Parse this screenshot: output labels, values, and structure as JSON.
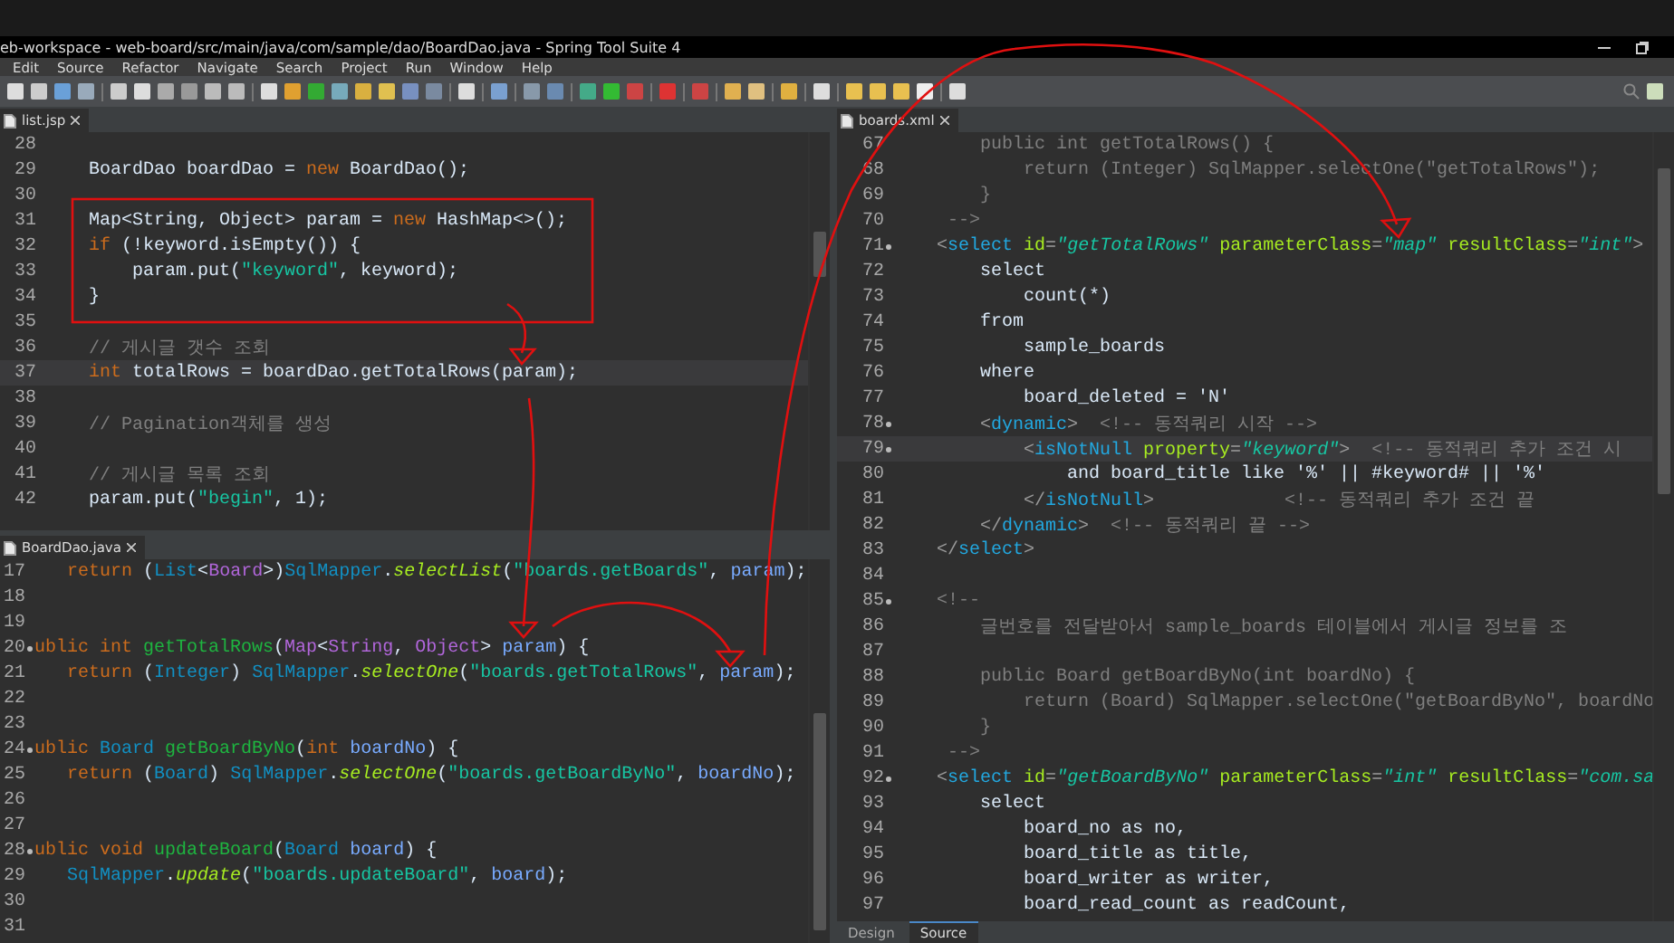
{
  "window": {
    "title": "eb-workspace - web-board/src/main/java/com/sample/dao/BoardDao.java - Spring Tool Suite 4"
  },
  "menu": [
    "Edit",
    "Source",
    "Refactor",
    "Navigate",
    "Search",
    "Project",
    "Run",
    "Window",
    "Help"
  ],
  "editors": [
    {
      "tab": "list.jsp",
      "lines": [
        {
          "number": "28",
          "fold": false,
          "current": false
        },
        {
          "number": "29",
          "fold": false,
          "current": false,
          "segments": [
            {
              "text": "    BoardDao boardDao = ",
              "kind": "plain"
            },
            {
              "text": "new",
              "kind": "kw"
            },
            {
              "text": " BoardDao();",
              "kind": "plain"
            }
          ]
        },
        {
          "number": "30",
          "fold": false,
          "current": false
        },
        {
          "number": "31",
          "fold": false,
          "current": false,
          "segments": [
            {
              "text": "    Map<String, Object> param = ",
              "kind": "plain"
            },
            {
              "text": "new",
              "kind": "kw"
            },
            {
              "text": " HashMap<>();",
              "kind": "plain"
            }
          ]
        },
        {
          "number": "32",
          "fold": false,
          "current": false,
          "segments": [
            {
              "text": "    if",
              "kind": "kw"
            },
            {
              "text": " (!keyword.isEmpty()) {",
              "kind": "plain"
            }
          ]
        },
        {
          "number": "33",
          "fold": false,
          "current": false,
          "segments": [
            {
              "text": "        param.put(",
              "kind": "plain"
            },
            {
              "text": "\"keyword\"",
              "kind": "str"
            },
            {
              "text": ", keyword);",
              "kind": "plain"
            }
          ]
        },
        {
          "number": "34",
          "fold": false,
          "current": false,
          "segments": [
            {
              "text": "    }",
              "kind": "plain"
            }
          ]
        },
        {
          "number": "35",
          "fold": false,
          "current": false
        },
        {
          "number": "36",
          "fold": false,
          "current": false,
          "segments": [
            {
              "text": "    // 게시글 갯수 조회",
              "kind": "cmt"
            }
          ]
        },
        {
          "number": "37",
          "fold": false,
          "current": true,
          "segments": [
            {
              "text": "    int",
              "kind": "kw"
            },
            {
              "text": " totalRows = boardDao.getTotalRows(param);",
              "kind": "plain"
            }
          ]
        },
        {
          "number": "38",
          "fold": false,
          "current": false
        },
        {
          "number": "39",
          "fold": false,
          "current": false,
          "segments": [
            {
              "text": "    // Pagination객체를 생성",
              "kind": "cmt"
            }
          ]
        },
        {
          "number": "40",
          "fold": false,
          "current": false
        },
        {
          "number": "41",
          "fold": false,
          "current": false,
          "segments": [
            {
              "text": "    // 게시글 목록 조회",
              "kind": "cmt"
            }
          ]
        },
        {
          "number": "42",
          "fold": false,
          "current": false,
          "segments": [
            {
              "text": "    param.put(",
              "kind": "plain"
            },
            {
              "text": "\"begin\"",
              "kind": "str"
            },
            {
              "text": ", 1);",
              "kind": "plain"
            }
          ]
        }
      ]
    },
    {
      "tab": "BoardDao.java",
      "lines": [
        {
          "number": "17",
          "fold": false,
          "current": false,
          "segments": [
            {
              "text": "   return",
              "kind": "kw"
            },
            {
              "text": " (",
              "kind": "plain"
            },
            {
              "text": "List",
              "kind": "type"
            },
            {
              "text": "<",
              "kind": "plain"
            },
            {
              "text": "Board",
              "kind": "generic"
            },
            {
              "text": ">)",
              "kind": "plain"
            },
            {
              "text": "SqlMapper",
              "kind": "type"
            },
            {
              "text": ".",
              "kind": "plain"
            },
            {
              "text": "selectList",
              "kind": "call"
            },
            {
              "text": "(",
              "kind": "plain"
            },
            {
              "text": "\"boards.getBoards\"",
              "kind": "str"
            },
            {
              "text": ", ",
              "kind": "plain"
            },
            {
              "text": "param",
              "kind": "var"
            },
            {
              "text": ");",
              "kind": "plain"
            }
          ]
        },
        {
          "number": "18",
          "fold": false,
          "current": false
        },
        {
          "number": "19",
          "fold": false,
          "current": false
        },
        {
          "number": "20",
          "fold": true,
          "current": false,
          "segments": [
            {
              "text": "ublic int",
              "kind": "kw"
            },
            {
              "text": " getTotalRows",
              "kind": "decl"
            },
            {
              "text": "(",
              "kind": "plain"
            },
            {
              "text": "Map",
              "kind": "generic"
            },
            {
              "text": "<",
              "kind": "plain"
            },
            {
              "text": "String",
              "kind": "generic"
            },
            {
              "text": ", ",
              "kind": "plain"
            },
            {
              "text": "Object",
              "kind": "generic"
            },
            {
              "text": "> ",
              "kind": "plain"
            },
            {
              "text": "param",
              "kind": "var"
            },
            {
              "text": ") {",
              "kind": "plain"
            }
          ]
        },
        {
          "number": "21",
          "fold": false,
          "current": false,
          "segments": [
            {
              "text": "   return",
              "kind": "kw"
            },
            {
              "text": " (",
              "kind": "plain"
            },
            {
              "text": "Integer",
              "kind": "type"
            },
            {
              "text": ") ",
              "kind": "plain"
            },
            {
              "text": "SqlMapper",
              "kind": "type"
            },
            {
              "text": ".",
              "kind": "plain"
            },
            {
              "text": "selectOne",
              "kind": "call"
            },
            {
              "text": "(",
              "kind": "plain"
            },
            {
              "text": "\"boards.getTotalRows\"",
              "kind": "str"
            },
            {
              "text": ", ",
              "kind": "plain"
            },
            {
              "text": "param",
              "kind": "var"
            },
            {
              "text": ");",
              "kind": "plain"
            }
          ]
        },
        {
          "number": "22",
          "fold": false,
          "current": false
        },
        {
          "number": "23",
          "fold": false,
          "current": false
        },
        {
          "number": "24",
          "fold": true,
          "current": false,
          "segments": [
            {
              "text": "ublic",
              "kind": "kw"
            },
            {
              "text": " Board",
              "kind": "type"
            },
            {
              "text": " getBoardByNo",
              "kind": "decl"
            },
            {
              "text": "(",
              "kind": "plain"
            },
            {
              "text": "int",
              "kind": "kw"
            },
            {
              "text": " boardNo",
              "kind": "var"
            },
            {
              "text": ") {",
              "kind": "plain"
            }
          ]
        },
        {
          "number": "25",
          "fold": false,
          "current": false,
          "segments": [
            {
              "text": "   return",
              "kind": "kw"
            },
            {
              "text": " (",
              "kind": "plain"
            },
            {
              "text": "Board",
              "kind": "type"
            },
            {
              "text": ") ",
              "kind": "plain"
            },
            {
              "text": "SqlMapper",
              "kind": "type"
            },
            {
              "text": ".",
              "kind": "plain"
            },
            {
              "text": "selectOne",
              "kind": "call"
            },
            {
              "text": "(",
              "kind": "plain"
            },
            {
              "text": "\"boards.getBoardByNo\"",
              "kind": "str"
            },
            {
              "text": ", ",
              "kind": "plain"
            },
            {
              "text": "boardNo",
              "kind": "var"
            },
            {
              "text": ");",
              "kind": "plain"
            }
          ]
        },
        {
          "number": "26",
          "fold": false,
          "current": false
        },
        {
          "number": "27",
          "fold": false,
          "current": false
        },
        {
          "number": "28",
          "fold": true,
          "current": false,
          "segments": [
            {
              "text": "ublic void",
              "kind": "kw"
            },
            {
              "text": " updateBoard",
              "kind": "decl"
            },
            {
              "text": "(",
              "kind": "plain"
            },
            {
              "text": "Board",
              "kind": "type"
            },
            {
              "text": " board",
              "kind": "var"
            },
            {
              "text": ") {",
              "kind": "plain"
            }
          ]
        },
        {
          "number": "29",
          "fold": false,
          "current": false,
          "segments": [
            {
              "text": "   SqlMapper",
              "kind": "type"
            },
            {
              "text": ".",
              "kind": "plain"
            },
            {
              "text": "update",
              "kind": "call"
            },
            {
              "text": "(",
              "kind": "plain"
            },
            {
              "text": "\"boards.updateBoard\"",
              "kind": "str"
            },
            {
              "text": ", ",
              "kind": "plain"
            },
            {
              "text": "board",
              "kind": "var"
            },
            {
              "text": ");",
              "kind": "plain"
            }
          ]
        },
        {
          "number": "30",
          "fold": false,
          "current": false
        },
        {
          "number": "31",
          "fold": false,
          "current": false
        }
      ]
    },
    {
      "tab": "boards.xml",
      "lines": [
        {
          "number": "67",
          "fold": false,
          "current": false,
          "segments": [
            {
              "text": "        public int getTotalRows() {",
              "kind": "cmt"
            }
          ]
        },
        {
          "number": "68",
          "fold": false,
          "current": false,
          "segments": [
            {
              "text": "            return (Integer) SqlMapper.selectOne(\"getTotalRows\");",
              "kind": "cmt"
            }
          ]
        },
        {
          "number": "69",
          "fold": false,
          "current": false,
          "segments": [
            {
              "text": "        }",
              "kind": "cmt"
            }
          ]
        },
        {
          "number": "70",
          "fold": false,
          "current": false,
          "segments": [
            {
              "text": "     -->",
              "kind": "cmt"
            }
          ]
        },
        {
          "number": "71",
          "fold": true,
          "current": false,
          "segments": [
            {
              "text": "    <",
              "kind": "punct"
            },
            {
              "text": "select",
              "kind": "tag"
            },
            {
              "text": " id",
              "kind": "attr"
            },
            {
              "text": "=",
              "kind": "punct"
            },
            {
              "text": "\"getTotalRows\"",
              "kind": "val"
            },
            {
              "text": " parameterClass",
              "kind": "attr"
            },
            {
              "text": "=",
              "kind": "punct"
            },
            {
              "text": "\"map\"",
              "kind": "val"
            },
            {
              "text": " resultClass",
              "kind": "attr"
            },
            {
              "text": "=",
              "kind": "punct"
            },
            {
              "text": "\"int\"",
              "kind": "val"
            },
            {
              "text": ">",
              "kind": "punct"
            }
          ]
        },
        {
          "number": "72",
          "fold": false,
          "current": false,
          "segments": [
            {
              "text": "        select",
              "kind": "plain"
            }
          ]
        },
        {
          "number": "73",
          "fold": false,
          "current": false,
          "segments": [
            {
              "text": "            count(*)",
              "kind": "plain"
            }
          ]
        },
        {
          "number": "74",
          "fold": false,
          "current": false,
          "segments": [
            {
              "text": "        from",
              "kind": "plain"
            }
          ]
        },
        {
          "number": "75",
          "fold": false,
          "current": false,
          "segments": [
            {
              "text": "            sample_boards",
              "kind": "plain"
            }
          ]
        },
        {
          "number": "76",
          "fold": false,
          "current": false,
          "segments": [
            {
              "text": "        where",
              "kind": "plain"
            }
          ]
        },
        {
          "number": "77",
          "fold": false,
          "current": false,
          "segments": [
            {
              "text": "            board_deleted = 'N'",
              "kind": "plain"
            }
          ]
        },
        {
          "number": "78",
          "fold": true,
          "current": false,
          "segments": [
            {
              "text": "        <",
              "kind": "punct"
            },
            {
              "text": "dynamic",
              "kind": "tag"
            },
            {
              "text": ">",
              "kind": "punct"
            },
            {
              "text": "  <!-- 동적쿼리 시작 -->",
              "kind": "cmt"
            }
          ]
        },
        {
          "number": "79",
          "fold": true,
          "current": true,
          "segments": [
            {
              "text": "            <",
              "kind": "punct"
            },
            {
              "text": "isNotNull",
              "kind": "tag"
            },
            {
              "text": " property",
              "kind": "attr"
            },
            {
              "text": "=",
              "kind": "punct"
            },
            {
              "text": "\"keyword\"",
              "kind": "val"
            },
            {
              "text": ">",
              "kind": "punct"
            },
            {
              "text": "  <!-- 동적쿼리 추가 조건 시",
              "kind": "cmt"
            }
          ]
        },
        {
          "number": "80",
          "fold": false,
          "current": false,
          "segments": [
            {
              "text": "                and board_title like '%' || #keyword# || '%'",
              "kind": "plain"
            }
          ]
        },
        {
          "number": "81",
          "fold": false,
          "current": false,
          "segments": [
            {
              "text": "            </",
              "kind": "punct"
            },
            {
              "text": "isNotNull",
              "kind": "tag"
            },
            {
              "text": ">",
              "kind": "punct"
            },
            {
              "text": "            <!-- 동적쿼리 추가 조건 끝",
              "kind": "cmt"
            }
          ]
        },
        {
          "number": "82",
          "fold": false,
          "current": false,
          "segments": [
            {
              "text": "        </",
              "kind": "punct"
            },
            {
              "text": "dynamic",
              "kind": "tag"
            },
            {
              "text": ">",
              "kind": "punct"
            },
            {
              "text": "  <!-- 동적쿼리 끝 -->",
              "kind": "cmt"
            }
          ]
        },
        {
          "number": "83",
          "fold": false,
          "current": false,
          "segments": [
            {
              "text": "    </",
              "kind": "punct"
            },
            {
              "text": "select",
              "kind": "tag"
            },
            {
              "text": ">",
              "kind": "punct"
            }
          ]
        },
        {
          "number": "84",
          "fold": false,
          "current": false
        },
        {
          "number": "85",
          "fold": true,
          "current": false,
          "segments": [
            {
              "text": "    <!--",
              "kind": "cmt"
            }
          ]
        },
        {
          "number": "86",
          "fold": false,
          "current": false,
          "segments": [
            {
              "text": "        글번호를 전달받아서 sample_boards 테이블에서 게시글 정보를 조",
              "kind": "cmt"
            }
          ]
        },
        {
          "number": "87",
          "fold": false,
          "current": false
        },
        {
          "number": "88",
          "fold": false,
          "current": false,
          "segments": [
            {
              "text": "        public Board getBoardByNo(int boardNo) {",
              "kind": "cmt"
            }
          ]
        },
        {
          "number": "89",
          "fold": false,
          "current": false,
          "segments": [
            {
              "text": "            return (Board) SqlMapper.selectOne(\"getBoardByNo\", boardNo",
              "kind": "cmt"
            }
          ]
        },
        {
          "number": "90",
          "fold": false,
          "current": false,
          "segments": [
            {
              "text": "        }",
              "kind": "cmt"
            }
          ]
        },
        {
          "number": "91",
          "fold": false,
          "current": false,
          "segments": [
            {
              "text": "     -->",
              "kind": "cmt"
            }
          ]
        },
        {
          "number": "92",
          "fold": true,
          "current": false,
          "segments": [
            {
              "text": "    <",
              "kind": "punct"
            },
            {
              "text": "select",
              "kind": "tag"
            },
            {
              "text": " id",
              "kind": "attr"
            },
            {
              "text": "=",
              "kind": "punct"
            },
            {
              "text": "\"getBoardByNo\"",
              "kind": "val"
            },
            {
              "text": " parameterClass",
              "kind": "attr"
            },
            {
              "text": "=",
              "kind": "punct"
            },
            {
              "text": "\"int\"",
              "kind": "val"
            },
            {
              "text": " resultClass",
              "kind": "attr"
            },
            {
              "text": "=",
              "kind": "punct"
            },
            {
              "text": "\"com.sa",
              "kind": "val"
            }
          ]
        },
        {
          "number": "93",
          "fold": false,
          "current": false,
          "segments": [
            {
              "text": "        select",
              "kind": "plain"
            }
          ]
        },
        {
          "number": "94",
          "fold": false,
          "current": false,
          "segments": [
            {
              "text": "            board_no as no,",
              "kind": "plain"
            }
          ]
        },
        {
          "number": "95",
          "fold": false,
          "current": false,
          "segments": [
            {
              "text": "            board_title as title,",
              "kind": "plain"
            }
          ]
        },
        {
          "number": "96",
          "fold": false,
          "current": false,
          "segments": [
            {
              "text": "            board_writer as writer,",
              "kind": "plain"
            }
          ]
        },
        {
          "number": "97",
          "fold": false,
          "current": false,
          "segments": [
            {
              "text": "            board_read_count as readCount,",
              "kind": "plain"
            }
          ]
        }
      ],
      "bottom_tabs": [
        {
          "label": "Design",
          "selected": false
        },
        {
          "label": "Source",
          "selected": true
        }
      ]
    }
  ]
}
